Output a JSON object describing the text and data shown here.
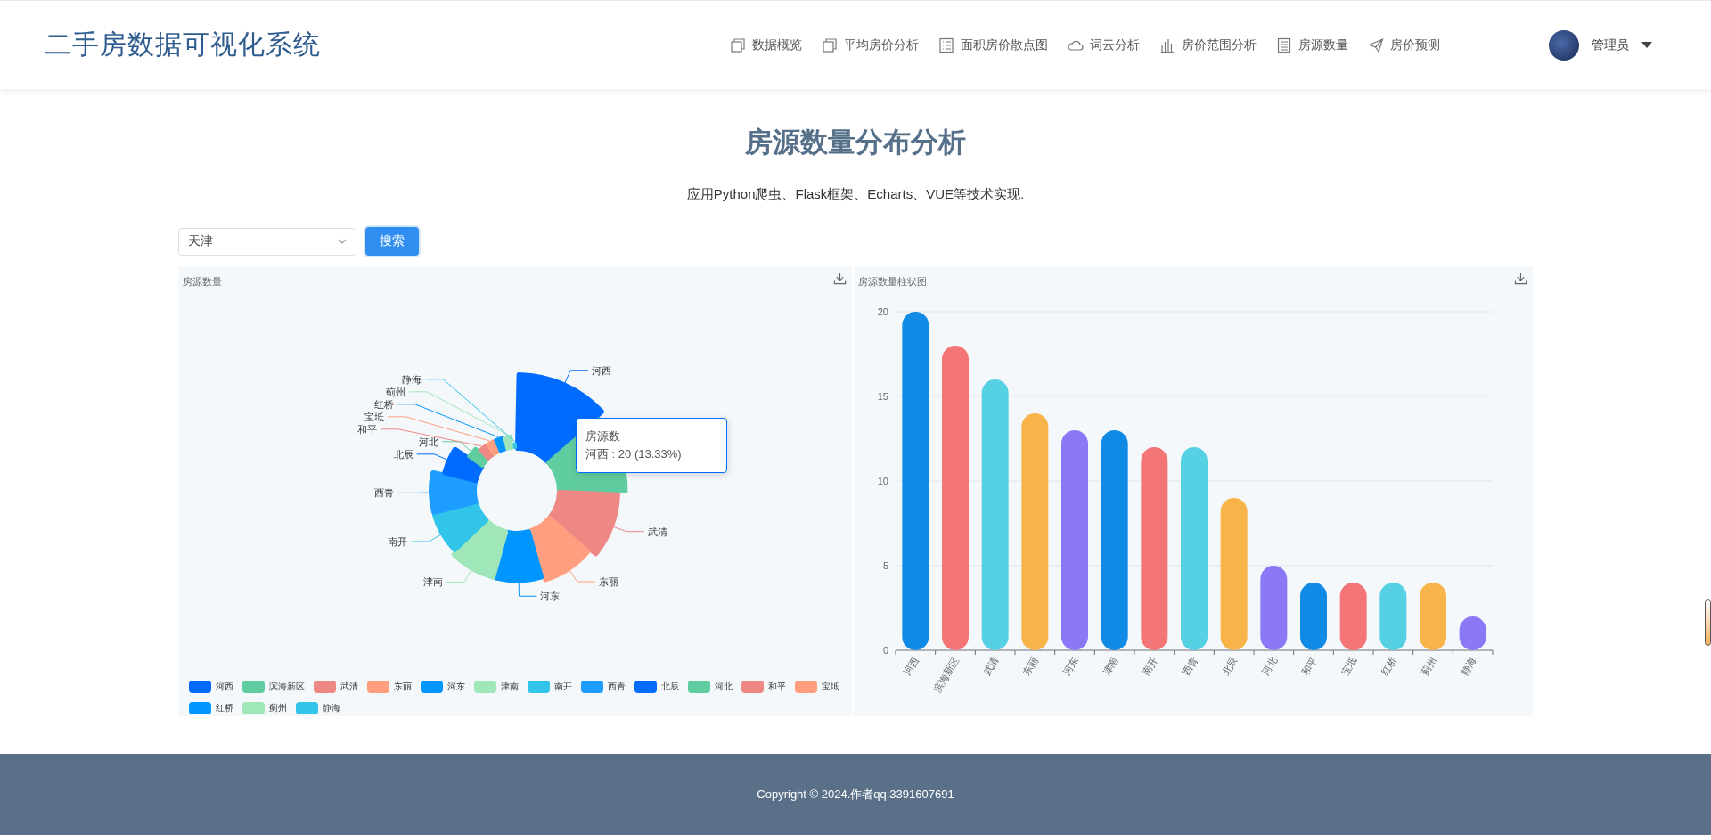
{
  "header": {
    "title": "二手房数据可视化系统",
    "nav": [
      {
        "label": "数据概览",
        "kind": "copy"
      },
      {
        "label": "平均房价分析",
        "kind": "copy"
      },
      {
        "label": "面积房价散点图",
        "kind": "list"
      },
      {
        "label": "词云分析",
        "kind": "cloud"
      },
      {
        "label": "房价范围分析",
        "kind": "bars"
      },
      {
        "label": "房源数量",
        "kind": "doc"
      },
      {
        "label": "房价预测",
        "kind": "send"
      }
    ],
    "user": {
      "name": "管理员"
    }
  },
  "page": {
    "title": "房源数量分布分析",
    "subtitle": "应用Python爬虫、Flask框架、Echarts、VUE等技术实现."
  },
  "filter": {
    "city": "天津",
    "button": "搜索"
  },
  "pie_panel": {
    "title": "房源数量",
    "legend": [
      {
        "label": "河西",
        "color": "#006cff"
      },
      {
        "label": "滨海新区",
        "color": "#60cda0"
      },
      {
        "label": "武清",
        "color": "#ed8884"
      },
      {
        "label": "东丽",
        "color": "#ff9f7f"
      },
      {
        "label": "河东",
        "color": "#0096ff"
      },
      {
        "label": "津南",
        "color": "#9fe6b8"
      },
      {
        "label": "南开",
        "color": "#32c5e9"
      },
      {
        "label": "西青",
        "color": "#1d9dff"
      },
      {
        "label": "北辰",
        "color": "#006cff"
      },
      {
        "label": "河北",
        "color": "#60cda0"
      },
      {
        "label": "和平",
        "color": "#ed8884"
      },
      {
        "label": "宝坻",
        "color": "#ff9f7f"
      },
      {
        "label": "红桥",
        "color": "#0096ff"
      },
      {
        "label": "蓟州",
        "color": "#9fe6b8"
      },
      {
        "label": "静海",
        "color": "#32c5e9"
      }
    ],
    "slice_labels": [
      {
        "text": "河西"
      },
      {
        "covered": true
      },
      {
        "text": "武清"
      },
      {
        "text": "东丽"
      },
      {
        "text": "河东"
      },
      {
        "text": "津南"
      },
      {
        "text": "南开"
      },
      {
        "text": "西青"
      },
      {
        "text": "北辰"
      },
      {
        "text": "河北"
      },
      {
        "text": "和平"
      },
      {
        "text": "宝坻"
      },
      {
        "text": "红桥"
      },
      {
        "text": "蓟州"
      },
      {
        "text": "静海"
      }
    ],
    "tooltip": {
      "title": "房源数",
      "text": "河西 : 20 (13.33%)"
    }
  },
  "bar_panel": {
    "title": "房源数量柱状图",
    "chart_data": {
      "type": "bar",
      "categories": [
        "河西",
        "滨海新区",
        "武清",
        "东丽",
        "河东",
        "津南",
        "南开",
        "西青",
        "北辰",
        "河北",
        "和平",
        "宝坻",
        "红桥",
        "蓟州",
        "静海"
      ],
      "series": [
        {
          "values": [
            20,
            18,
            16,
            14,
            13,
            13,
            12,
            12,
            9,
            5,
            4,
            4,
            4,
            4,
            2
          ]
        }
      ],
      "grid": true,
      "colors": [
        "#118ae6",
        "#f47575",
        "#56d0e3",
        "#f8b448",
        "#8b78f6"
      ],
      "ylim": [
        0,
        20
      ],
      "yticks": [
        0,
        5,
        10,
        15,
        20
      ]
    }
  },
  "footer": {
    "text": "Copyright © 2024.作者qq:3391607691"
  }
}
